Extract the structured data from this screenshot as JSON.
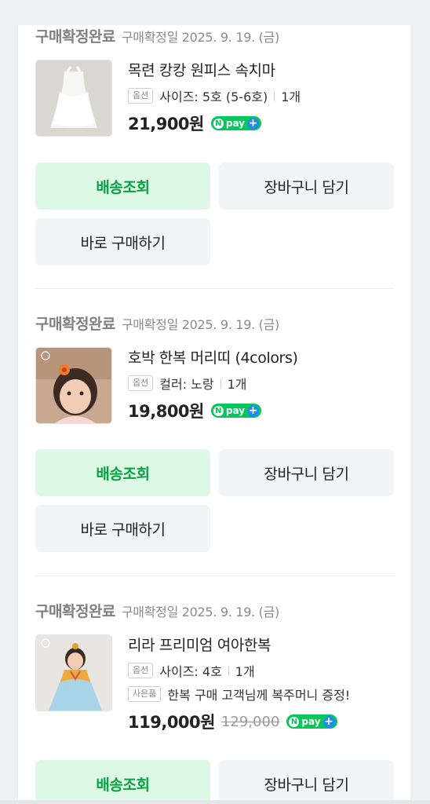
{
  "orders": [
    {
      "status": "구매확정완료",
      "date": "구매확정일 2025. 9. 19. (금)",
      "product_name": "목련 캉캉 원피스 속치마",
      "option_tag": "옵션",
      "option_value": "사이즈: 5호 (5-6호)",
      "quantity": "1개",
      "price": "21,900원",
      "npay_label": "pay",
      "buttons": {
        "tracking": "배송조회",
        "cart": "장바구니 담기",
        "buy_now": "바로 구매하기"
      }
    },
    {
      "status": "구매확정완료",
      "date": "구매확정일 2025. 9. 19. (금)",
      "product_name": "호박 한복 머리띠 (4colors)",
      "option_tag": "옵션",
      "option_value": "컬러: 노랑",
      "quantity": "1개",
      "price": "19,800원",
      "npay_label": "pay",
      "buttons": {
        "tracking": "배송조회",
        "cart": "장바구니 담기",
        "buy_now": "바로 구매하기"
      }
    },
    {
      "status": "구매확정완료",
      "date": "구매확정일 2025. 9. 19. (금)",
      "product_name": "리라 프리미엄 여아한복",
      "option_tag": "옵션",
      "option_value": "사이즈: 4호",
      "quantity": "1개",
      "gift_tag": "사은품",
      "gift_text": "한복 구매 고객님께 복주머니 증정!",
      "price": "119,000원",
      "original_price": "129,000",
      "npay_label": "pay",
      "buttons": {
        "tracking": "배송조회",
        "cart": "장바구니 담기"
      }
    }
  ],
  "colors": {
    "accent_green": "#03c75a",
    "tracking_button_bg": "#ddf8e4",
    "tracking_button_text": "#0aa045",
    "gray_button_bg": "#f2f4f6"
  }
}
